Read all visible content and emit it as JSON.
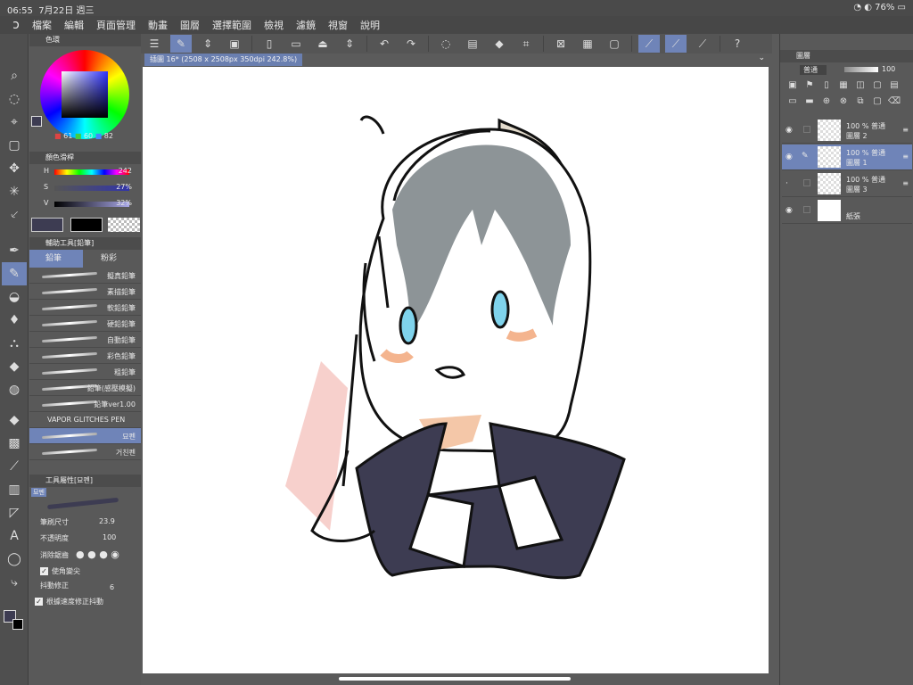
{
  "status": {
    "time": "06:55",
    "date": "7月22日 週三",
    "battery": "76%"
  },
  "menu": {
    "app_icon": "clip-studio-icon",
    "items": [
      "檔案",
      "編輯",
      "頁面管理",
      "動畫",
      "圖層",
      "選擇範圍",
      "檢視",
      "濾鏡",
      "視窗",
      "說明"
    ]
  },
  "document": {
    "tab_label": "插圖 16* (2508 x 2508px 350dpi 242.8%)"
  },
  "color_wheel": {
    "title": "色環",
    "r": "61",
    "g": "60",
    "b": "82"
  },
  "color_slider": {
    "title": "顏色滑桿",
    "h_label": "H",
    "h_value": "242",
    "s_label": "S",
    "s_value": "27%",
    "v_label": "V",
    "v_value": "32%"
  },
  "subtool": {
    "title": "輔助工具[鉛筆]",
    "tabs": [
      "鉛筆",
      "粉彩"
    ],
    "brushes": [
      "擬真鉛筆",
      "素描鉛筆",
      "軟鉛鉛筆",
      "硬鉛鉛筆",
      "自動鉛筆",
      "彩色鉛筆",
      "粗鉛筆",
      "鉛筆(感壓模擬)",
      "鉛筆ver1.00",
      "VAPOR GLITCHES PEN",
      "묘펜",
      "거친펜"
    ]
  },
  "tool_property": {
    "title": "工具屬性[묘펜]",
    "preset_name": "묘펜",
    "brush_size_label": "筆刷尺寸",
    "brush_size": "23.9",
    "opacity_label": "不透明度",
    "opacity": "100",
    "antialias_label": "消除鋸齒",
    "corner_label": "使角變尖",
    "stabilize_label": "抖動修正",
    "stabilize_value": "6",
    "speed_label": "根據速度修正抖動"
  },
  "layers": {
    "title": "圖層",
    "blend_mode": "普通",
    "opacity": "100",
    "items": [
      {
        "l1": "100 % 普通",
        "l2": "圖層 2"
      },
      {
        "l1": "100 % 普通",
        "l2": "圖層 1"
      },
      {
        "l1": "100 % 普通",
        "l2": "圖層 3"
      },
      {
        "l1": "",
        "l2": "紙張"
      }
    ]
  },
  "colors": {
    "accent": "#6f84b8",
    "main_color": "#3d3c52",
    "sub_color": "#000000"
  }
}
